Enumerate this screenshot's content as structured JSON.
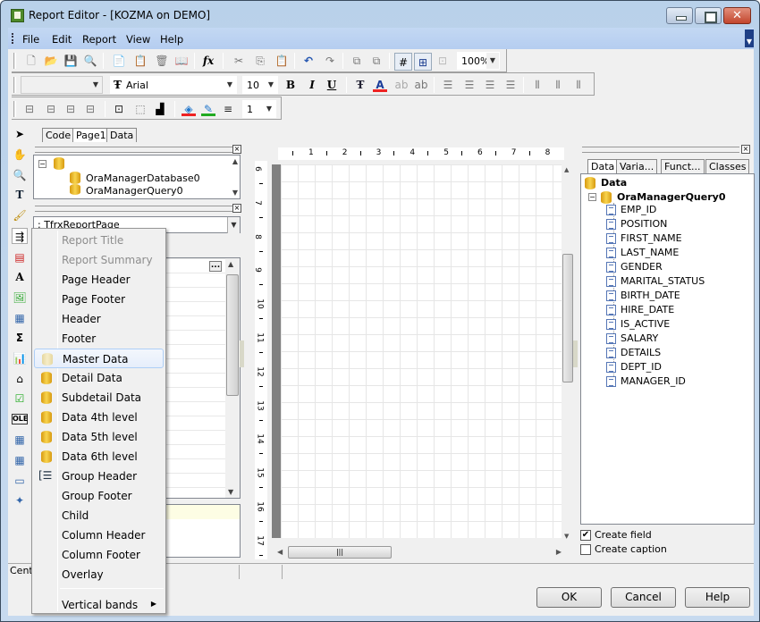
{
  "window": {
    "title": "Report Editor - [KOZMA on DEMO]"
  },
  "menubar": {
    "items": [
      "File",
      "Edit",
      "Report",
      "View",
      "Help"
    ]
  },
  "toolbar": {
    "zoom": "100%",
    "font_name": "Arial",
    "font_size": "10",
    "style_combo": "",
    "frame_width": "1",
    "standard_icons": [
      "new-icon",
      "open-icon",
      "save-icon",
      "preview-icon",
      "new-report-icon",
      "new-page-icon",
      "delete-page-icon",
      "page-settings-icon",
      "function-icon",
      "cut-icon",
      "copy-icon",
      "paste-icon",
      "undo-icon",
      "redo-icon",
      "group-icon",
      "ungroup-icon",
      "show-grid-icon",
      "align-to-grid-icon",
      "fit-to-grid-icon"
    ],
    "format_icons": [
      "bold-icon",
      "italic-icon",
      "underline-icon",
      "font-settings-icon",
      "font-color-icon",
      "highlight-icon",
      "rotation-icon",
      "align-left-icon",
      "align-center-icon",
      "align-right-icon",
      "justify-icon",
      "align-top-icon",
      "align-middle-icon",
      "align-bottom-icon"
    ],
    "border_icons": [
      "top-line-icon",
      "bottom-line-icon",
      "left-line-icon",
      "right-line-icon",
      "all-frame-lines-icon",
      "no-frame-icon",
      "shadow-icon",
      "fill-color-icon",
      "frame-color-icon",
      "frame-style-icon"
    ]
  },
  "tabs": [
    "Code",
    "Page1",
    "Data"
  ],
  "active_tab": "Page1",
  "report_tree": {
    "items": [
      "OraManagerDatabase0",
      "OraManagerQuery0"
    ]
  },
  "object_inspector": {
    "selected_object": ": TfrxReportPage",
    "status_text": "Cent"
  },
  "insert_band_menu": {
    "items": [
      {
        "label": "Report Title",
        "disabled": true,
        "icon": ""
      },
      {
        "label": "Report Summary",
        "disabled": true,
        "icon": ""
      },
      {
        "label": "Page Header",
        "icon": ""
      },
      {
        "label": "Page Footer",
        "icon": ""
      },
      {
        "label": "Header",
        "icon": ""
      },
      {
        "label": "Footer",
        "icon": ""
      },
      {
        "label": "Master Data",
        "icon": "database-icon",
        "highlighted": true
      },
      {
        "label": "Detail Data",
        "icon": "database-icon"
      },
      {
        "label": "Subdetail Data",
        "icon": "database-icon"
      },
      {
        "label": "Data 4th level",
        "icon": "database-icon"
      },
      {
        "label": "Data 5th level",
        "icon": "database-icon"
      },
      {
        "label": "Data 6th level",
        "icon": "database-icon"
      },
      {
        "label": "Group Header",
        "icon": "group-header-icon"
      },
      {
        "label": "Group Footer",
        "icon": ""
      },
      {
        "label": "Child",
        "icon": ""
      },
      {
        "label": "Column Header",
        "icon": ""
      },
      {
        "label": "Column Footer",
        "icon": ""
      },
      {
        "label": "Overlay",
        "icon": ""
      }
    ],
    "submenu": "Vertical bands"
  },
  "rulers": {
    "horizontal": [
      "1",
      "2",
      "3",
      "4",
      "5",
      "6",
      "7",
      "8"
    ],
    "vertical": [
      "6",
      "7",
      "8",
      "9",
      "10",
      "11",
      "12",
      "13",
      "14",
      "15",
      "16",
      "17"
    ]
  },
  "data_tree": {
    "tabs": [
      "Data",
      "Varia...",
      "Funct...",
      "Classes"
    ],
    "root": "Data",
    "query": "OraManagerQuery0",
    "fields": [
      "EMP_ID",
      "POSITION",
      "FIRST_NAME",
      "LAST_NAME",
      "GENDER",
      "MARITAL_STATUS",
      "BIRTH_DATE",
      "HIRE_DATE",
      "IS_ACTIVE",
      "SALARY",
      "DETAILS",
      "DEPT_ID",
      "MANAGER_ID"
    ],
    "create_field": {
      "label": "Create field",
      "checked": true
    },
    "create_caption": {
      "label": "Create caption",
      "checked": false
    }
  },
  "buttons": {
    "ok": "OK",
    "cancel": "Cancel",
    "help": "Help"
  }
}
